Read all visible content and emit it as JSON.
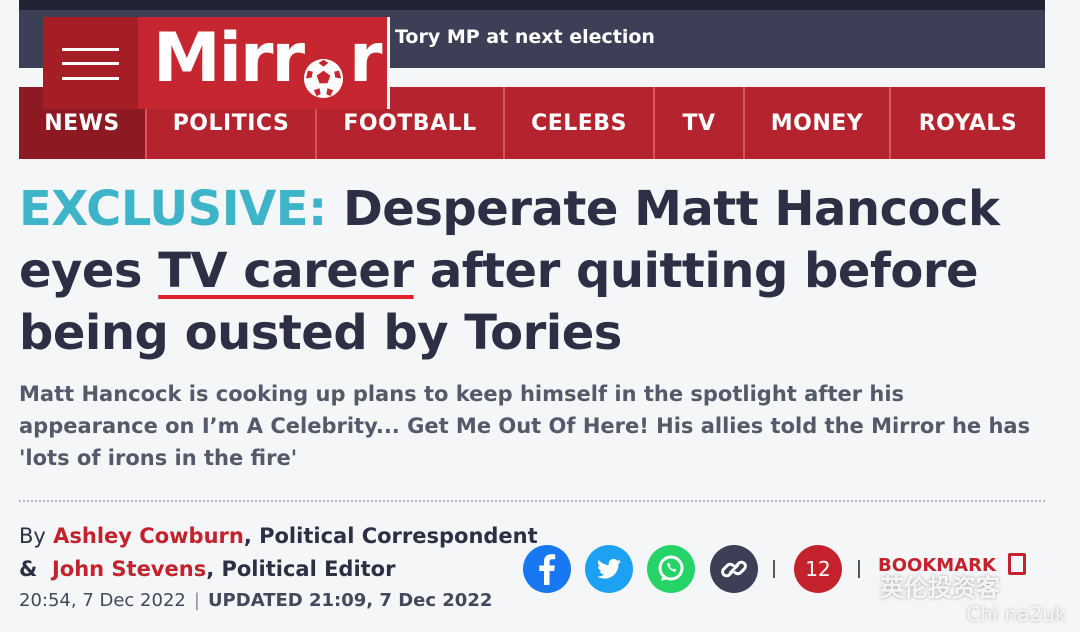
{
  "top_story": {
    "text": "Tory MP at next election"
  },
  "logo": {
    "text": "Mirr",
    "text_end": "r"
  },
  "nav": {
    "items": [
      {
        "label": "NEWS"
      },
      {
        "label": "POLITICS"
      },
      {
        "label": "FOOTBALL"
      },
      {
        "label": "CELEBS"
      },
      {
        "label": "TV"
      },
      {
        "label": "MONEY"
      },
      {
        "label": "ROYALS"
      }
    ]
  },
  "article": {
    "exclusive_label": "EXCLUSIVE:",
    "headline_part1": "Desperate Matt Hancock eyes",
    "headline_link": "TV career",
    "headline_part2": "after quitting before being ousted by Tories",
    "standfirst": "Matt Hancock is cooking up plans to keep himself in the spotlight after his appearance on I’m A Celebrity... Get Me Out Of Here! His allies told the Mirror he has 'lots of irons in the fire'",
    "by": "By",
    "author1": "Ashley Cowburn",
    "author1_role": ", Political Correspondent",
    "amp": "&",
    "author2": "John Stevens",
    "author2_role": ", Political Editor",
    "published": "20:54, 7 Dec 2022",
    "updated": "UPDATED 21:09, 7 Dec 2022"
  },
  "actions": {
    "comments_count": "12",
    "bookmark_label": "BOOKMARK"
  },
  "share_icons": [
    "facebook-icon",
    "twitter-icon",
    "whatsapp-icon",
    "link-icon"
  ],
  "watermark": {
    "line1": "英伦投资客",
    "line2": "Chi na2uk"
  },
  "colors": {
    "brand_red": "#c6262f",
    "exclusive_blue": "#3eb4c9",
    "facebook": "#1877f2",
    "twitter": "#1da1f2",
    "whatsapp": "#25d366"
  }
}
